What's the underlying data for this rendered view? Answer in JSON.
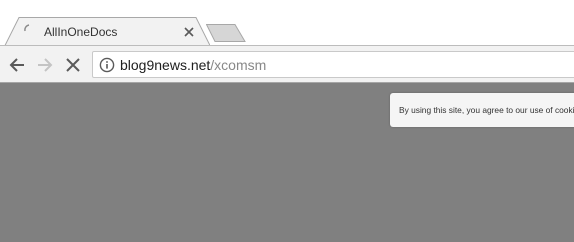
{
  "browser": {
    "tab": {
      "title": "AllInOneDocs",
      "loading": true
    },
    "address_bar": {
      "host": "blog9news.net",
      "path": "/xcomsm"
    }
  },
  "page": {
    "background_color": "#808080",
    "cookie_banner": {
      "text": "By using this site, you agree to our use of cookies"
    }
  },
  "icons": {
    "tab_loading": "spinner-icon",
    "tab_close": "close-icon",
    "back": "arrow-left-icon",
    "forward": "arrow-right-icon",
    "stop": "stop-icon",
    "site_info": "info-icon"
  }
}
